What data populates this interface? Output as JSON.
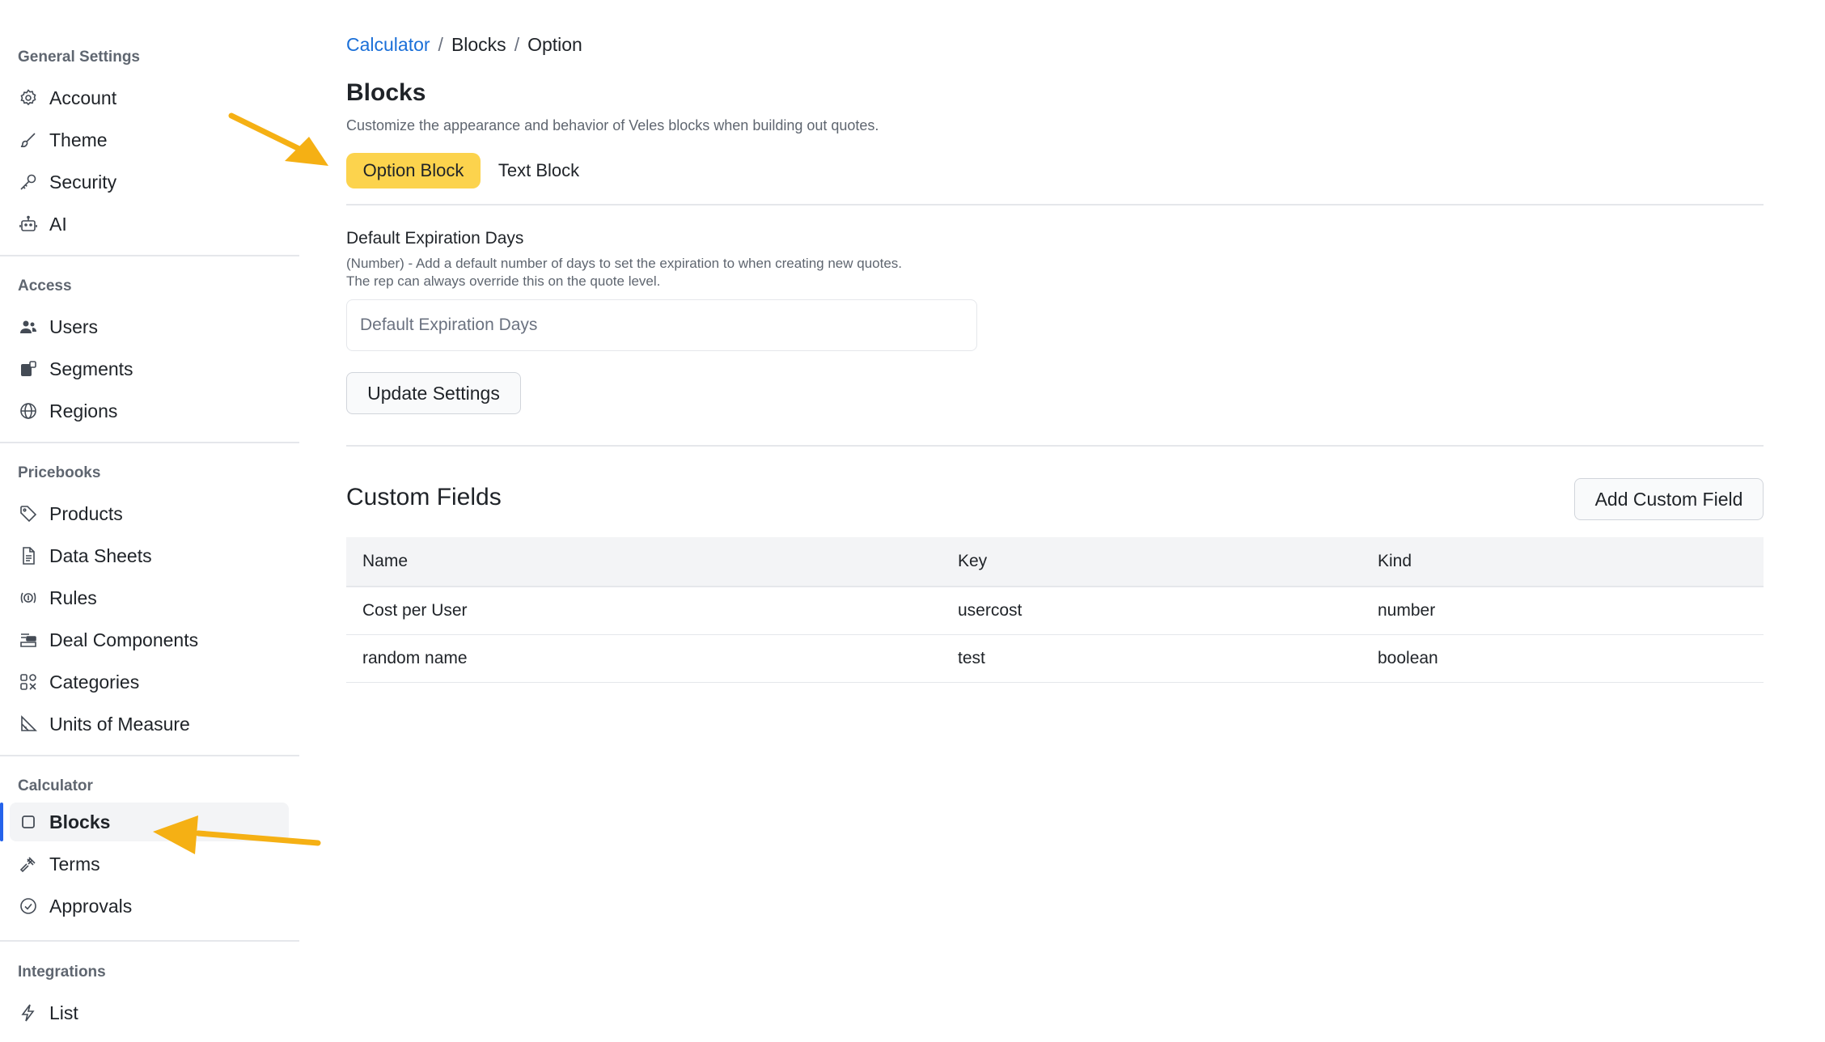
{
  "sidebar": {
    "sections": [
      {
        "title": "General Settings",
        "items": [
          {
            "label": "Account",
            "icon": "gear-icon"
          },
          {
            "label": "Theme",
            "icon": "brush-icon"
          },
          {
            "label": "Security",
            "icon": "key-icon"
          },
          {
            "label": "AI",
            "icon": "robot-icon"
          }
        ]
      },
      {
        "title": "Access",
        "items": [
          {
            "label": "Users",
            "icon": "users-icon"
          },
          {
            "label": "Segments",
            "icon": "segments-icon"
          },
          {
            "label": "Regions",
            "icon": "globe-icon"
          }
        ]
      },
      {
        "title": "Pricebooks",
        "items": [
          {
            "label": "Products",
            "icon": "tag-icon"
          },
          {
            "label": "Data Sheets",
            "icon": "document-icon"
          },
          {
            "label": "Rules",
            "icon": "rules-icon"
          },
          {
            "label": "Deal Components",
            "icon": "components-icon"
          },
          {
            "label": "Categories",
            "icon": "categories-icon"
          },
          {
            "label": "Units of Measure",
            "icon": "ruler-icon"
          }
        ]
      },
      {
        "title": "Calculator",
        "items": [
          {
            "label": "Blocks",
            "icon": "square-icon",
            "active": true
          },
          {
            "label": "Terms",
            "icon": "gavel-icon"
          },
          {
            "label": "Approvals",
            "icon": "check-circle-icon"
          }
        ]
      },
      {
        "title": "Integrations",
        "items": [
          {
            "label": "List",
            "icon": "lightning-icon"
          }
        ]
      }
    ]
  },
  "breadcrumb": {
    "root": "Calculator",
    "middle": "Blocks",
    "current": "Option",
    "separator": "/"
  },
  "page": {
    "title": "Blocks",
    "description": "Customize the appearance and behavior of Veles blocks when building out quotes."
  },
  "tabs": [
    {
      "label": "Option Block",
      "active": true
    },
    {
      "label": "Text Block",
      "active": false
    }
  ],
  "settings": {
    "field_label": "Default Expiration Days",
    "help_line1": "(Number) - Add a default number of days to set the expiration to when creating new quotes.",
    "help_line2": "The rep can always override this on the quote level.",
    "input_placeholder": "Default Expiration Days",
    "input_value": "",
    "update_button": "Update Settings"
  },
  "custom_fields": {
    "title": "Custom Fields",
    "add_button": "Add Custom Field",
    "columns": [
      "Name",
      "Key",
      "Kind"
    ],
    "rows": [
      [
        "Cost per User",
        "usercost",
        "number"
      ],
      [
        "random name",
        "test",
        "boolean"
      ]
    ]
  },
  "colors": {
    "accent": "#fcd34d",
    "link": "#1a6fd8",
    "active_bar": "#2563eb",
    "annotation_arrow": "#f5b014"
  }
}
